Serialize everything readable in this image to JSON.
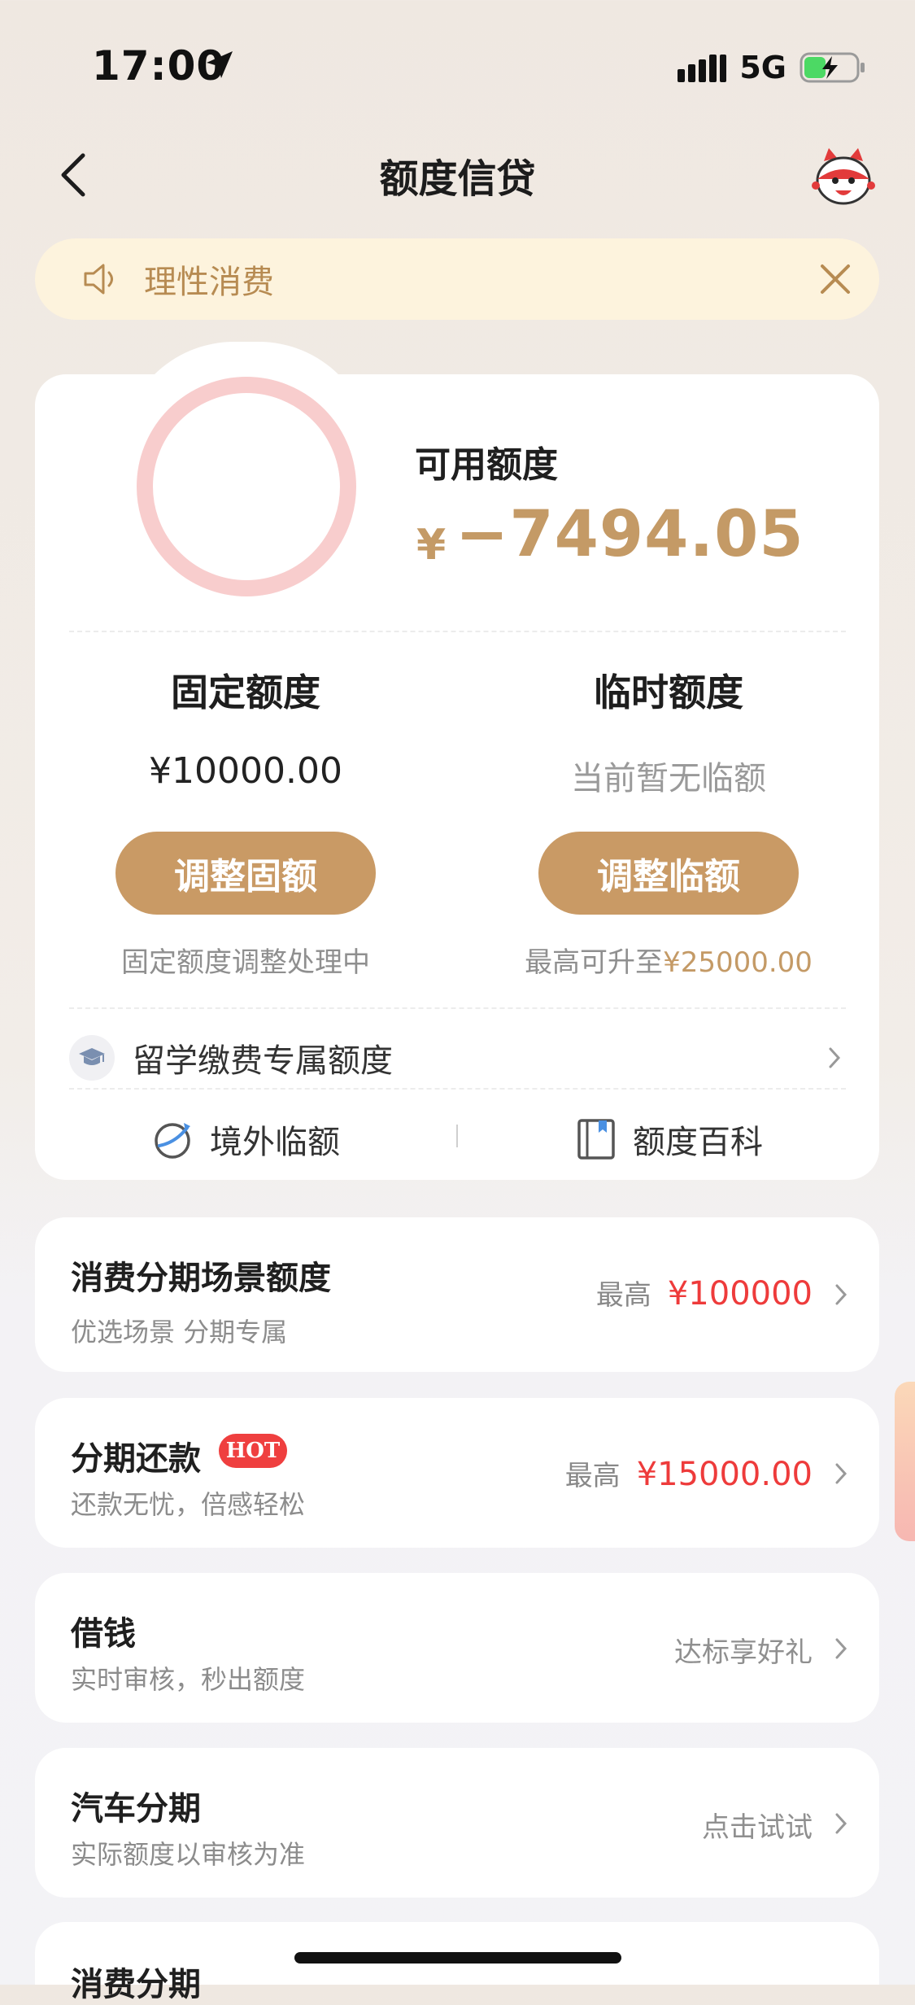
{
  "status_bar": {
    "time": "17:00",
    "network": "5G"
  },
  "nav": {
    "title": "额度信贷"
  },
  "notice": {
    "text": "理性消费"
  },
  "credit": {
    "available_label": "可用额度",
    "currency": "¥",
    "available_amount": "−7494.05",
    "fixed": {
      "title": "固定额度",
      "value": "¥10000.00",
      "button": "调整固额",
      "note": "固定额度调整处理中"
    },
    "temporary": {
      "title": "临时额度",
      "value": "当前暂无临额",
      "button": "调整临额",
      "note_prefix": "最高可升至",
      "note_amount": "¥25000.00"
    },
    "study_abroad": "留学缴费专属额度",
    "tools": [
      {
        "label": "境外临额"
      },
      {
        "label": "额度百科"
      }
    ]
  },
  "items": [
    {
      "title": "消费分期场景额度",
      "subtitle": "优选场景 分期专属",
      "right_prefix": "最高",
      "right_amount": "¥100000"
    },
    {
      "title": "分期还款",
      "badge": "HOT",
      "subtitle": "还款无忧，倍感轻松",
      "right_prefix": "最高",
      "right_amount": "¥15000.00"
    },
    {
      "title": "借钱",
      "subtitle": "实时审核，秒出额度",
      "right_text": "达标享好礼"
    },
    {
      "title": "汽车分期",
      "subtitle": "实际额度以审核为准",
      "right_text": "点击试试"
    },
    {
      "title": "消费分期"
    }
  ],
  "colors": {
    "gold": "#c99a65",
    "red": "#ee3b3b",
    "notice_bg": "#fdf3dd",
    "ring": "#f8cdcd"
  }
}
